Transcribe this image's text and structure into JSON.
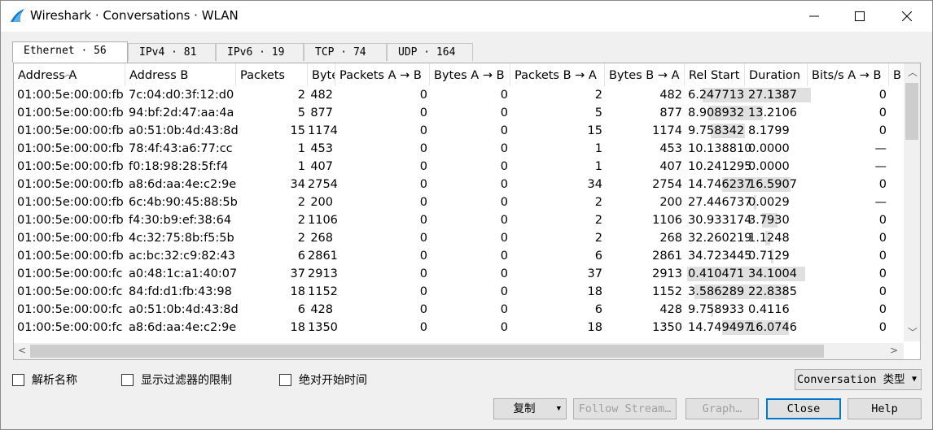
{
  "window": {
    "title": "Wireshark · Conversations · WLAN"
  },
  "tabs": [
    {
      "label": "Ethernet · 56"
    },
    {
      "label": "IPv4 · 81"
    },
    {
      "label": "IPv6 · 19"
    },
    {
      "label": "TCP · 74"
    },
    {
      "label": "UDP · 164"
    }
  ],
  "columns": [
    "Address A",
    "Address B",
    "Packets",
    "Bytes",
    "Packets A → B",
    "Bytes A → B",
    "Packets B → A",
    "Bytes B → A",
    "Rel Start",
    "Duration",
    "Bits/s A → B",
    "Bi"
  ],
  "rows": [
    {
      "a": "01:00:5e:00:00:fb",
      "b": "7c:04:d0:3f:12:d0",
      "packets": "2",
      "bytes": "482",
      "pab": "0",
      "bab": "0",
      "pba": "2",
      "bba": "482",
      "start": "6.247713",
      "duration": "27.1387",
      "bps": "0",
      "start_frac": 0.23,
      "dur_frac": 0.92
    },
    {
      "a": "01:00:5e:00:00:fb",
      "b": "94:bf:2d:47:aa:4a",
      "packets": "5",
      "bytes": "877",
      "pab": "0",
      "bab": "0",
      "pba": "5",
      "bba": "877",
      "start": "8.908932",
      "duration": "13.2106",
      "bps": "0",
      "start_frac": 0.31,
      "dur_frac": 0.46
    },
    {
      "a": "01:00:5e:00:00:fb",
      "b": "a0:51:0b:4d:43:8d",
      "packets": "15",
      "bytes": "1174",
      "pab": "0",
      "bab": "0",
      "pba": "15",
      "bba": "1174",
      "start": "9.758342",
      "duration": "8.1799",
      "bps": "0",
      "start_frac": 0.34,
      "dur_frac": 0.29
    },
    {
      "a": "01:00:5e:00:00:fb",
      "b": "78:4f:43:a6:77:cc",
      "packets": "1",
      "bytes": "453",
      "pab": "0",
      "bab": "0",
      "pba": "1",
      "bba": "453",
      "start": "10.138810",
      "duration": "0.0000",
      "bps": "—",
      "start_frac": 0.35,
      "dur_frac": 0.0
    },
    {
      "a": "01:00:5e:00:00:fb",
      "b": "f0:18:98:28:5f:f4",
      "packets": "1",
      "bytes": "407",
      "pab": "0",
      "bab": "0",
      "pba": "1",
      "bba": "407",
      "start": "10.241295",
      "duration": "0.0000",
      "bps": "—",
      "start_frac": 0.36,
      "dur_frac": 0.0
    },
    {
      "a": "01:00:5e:00:00:fb",
      "b": "a8:6d:aa:4e:c2:9e",
      "packets": "34",
      "bytes": "2754",
      "pab": "0",
      "bab": "0",
      "pba": "34",
      "bba": "2754",
      "start": "14.746237",
      "duration": "16.5907",
      "bps": "0",
      "start_frac": 0.51,
      "dur_frac": 0.58
    },
    {
      "a": "01:00:5e:00:00:fb",
      "b": "6c:4b:90:45:88:5b",
      "packets": "2",
      "bytes": "200",
      "pab": "0",
      "bab": "0",
      "pba": "2",
      "bba": "200",
      "start": "27.446737",
      "duration": "0.0029",
      "bps": "—",
      "start_frac": 0.95,
      "dur_frac": 0.01
    },
    {
      "a": "01:00:5e:00:00:fb",
      "b": "f4:30:b9:ef:38:64",
      "packets": "2",
      "bytes": "1106",
      "pab": "0",
      "bab": "0",
      "pba": "2",
      "bba": "1106",
      "start": "30.933174",
      "duration": "3.7930",
      "bps": "0",
      "start_frac": 1.07,
      "dur_frac": 0.13
    },
    {
      "a": "01:00:5e:00:00:fb",
      "b": "4c:32:75:8b:f5:5b",
      "packets": "2",
      "bytes": "268",
      "pab": "0",
      "bab": "0",
      "pba": "2",
      "bba": "268",
      "start": "32.260219",
      "duration": "1.1248",
      "bps": "0",
      "start_frac": 1.12,
      "dur_frac": 0.04
    },
    {
      "a": "01:00:5e:00:00:fb",
      "b": "ac:bc:32:c9:82:43",
      "packets": "6",
      "bytes": "2861",
      "pab": "0",
      "bab": "0",
      "pba": "6",
      "bba": "2861",
      "start": "34.723445",
      "duration": "0.7129",
      "bps": "0",
      "start_frac": 1.2,
      "dur_frac": 0.02
    },
    {
      "a": "01:00:5e:00:00:fc",
      "b": "a0:48:1c:a1:40:07",
      "packets": "37",
      "bytes": "2913",
      "pab": "0",
      "bab": "0",
      "pba": "37",
      "bba": "2913",
      "start": "0.410471",
      "duration": "34.1004",
      "bps": "0",
      "start_frac": 0.01,
      "dur_frac": 1.0
    },
    {
      "a": "01:00:5e:00:00:fc",
      "b": "84:fd:d1:fb:43:98",
      "packets": "18",
      "bytes": "1152",
      "pab": "0",
      "bab": "0",
      "pba": "18",
      "bba": "1152",
      "start": "3.586289",
      "duration": "22.8385",
      "bps": "0",
      "start_frac": 0.12,
      "dur_frac": 0.79
    },
    {
      "a": "01:00:5e:00:00:fc",
      "b": "a0:51:0b:4d:43:8d",
      "packets": "6",
      "bytes": "428",
      "pab": "0",
      "bab": "0",
      "pba": "6",
      "bba": "428",
      "start": "9.758933",
      "duration": "0.4116",
      "bps": "0",
      "start_frac": 0.34,
      "dur_frac": 0.01
    },
    {
      "a": "01:00:5e:00:00:fc",
      "b": "a8:6d:aa:4e:c2:9e",
      "packets": "18",
      "bytes": "1350",
      "pab": "0",
      "bab": "0",
      "pba": "18",
      "bba": "1350",
      "start": "14.749497",
      "duration": "16.0746",
      "bps": "0",
      "start_frac": 0.51,
      "dur_frac": 0.56
    }
  ],
  "options": {
    "resolve_names": "解析名称",
    "limit_to_filter": "显示过滤器的限制",
    "absolute_start": "绝对开始时间"
  },
  "conversation_type": "Conversation 类型",
  "buttons": {
    "copy": "复制",
    "follow_stream": "Follow Stream…",
    "graph": "Graph…",
    "close": "Close",
    "help": "Help"
  },
  "colors": {
    "bar": "#e0e0e0",
    "accent": "#0078d7"
  }
}
